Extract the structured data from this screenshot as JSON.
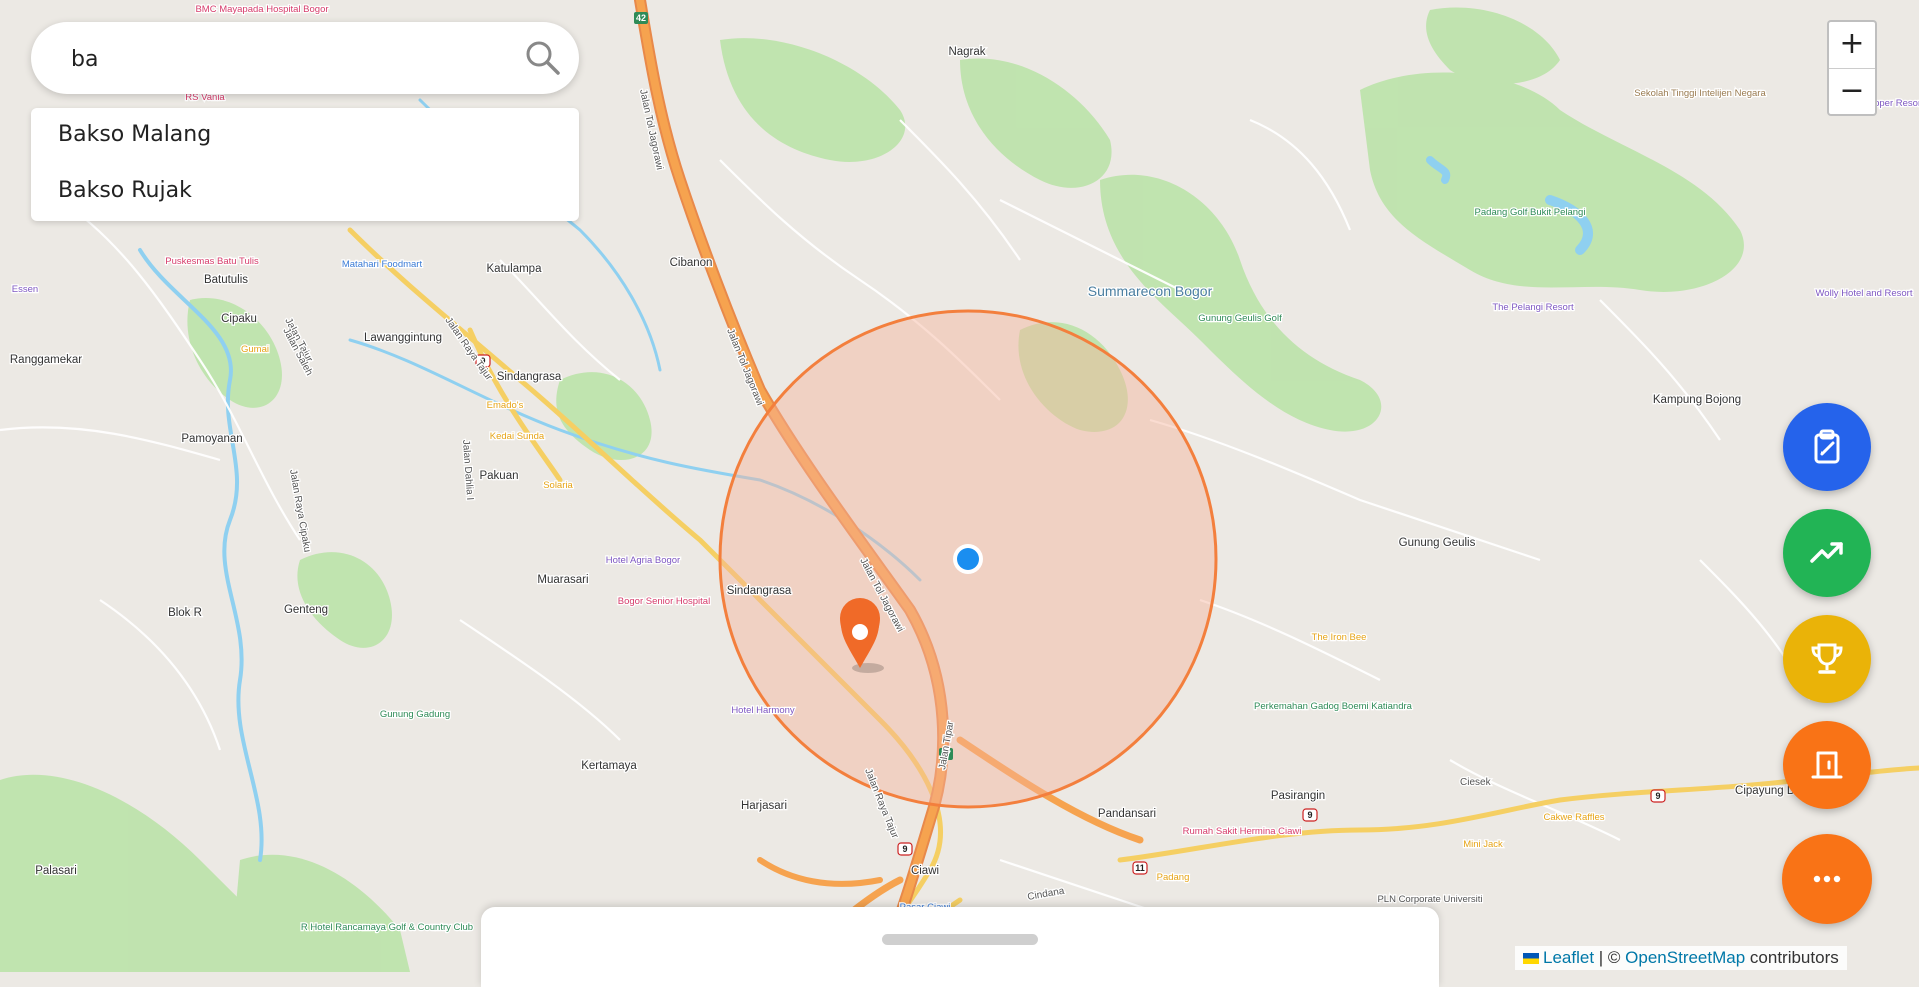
{
  "search": {
    "value": "ba",
    "placeholder": ""
  },
  "suggestions": [
    "Bakso Malang",
    "Bakso Rujak"
  ],
  "zoom": {
    "in_label": "+",
    "out_label": "−"
  },
  "attribution": {
    "leaflet": "Leaflet",
    "sep": " | © ",
    "osm": "OpenStreetMap",
    "suffix": " contributors"
  },
  "fabs": [
    {
      "name": "clipboard-icon",
      "color": "#2563eb"
    },
    {
      "name": "trend-up-icon",
      "color": "#22b455"
    },
    {
      "name": "trophy-icon",
      "color": "#eab308"
    },
    {
      "name": "exit-door-icon",
      "color": "#f97316"
    },
    {
      "name": "more-dots-icon",
      "color": "#f97316"
    }
  ],
  "colors": {
    "radius_fill": "#f7b49b",
    "radius_stroke": "#f37f3d",
    "user_dot": "#1a8ef0",
    "pin": "#f06a28",
    "park": "#a6dd92",
    "road_major": "#f39a3b",
    "road_secondary": "#f5cf63",
    "water": "#8fd0f0"
  },
  "map_labels": {
    "places": [
      "Nagrak",
      "Cibanon",
      "Katulampa",
      "Batutulis",
      "Cipaku",
      "Lawanggintung",
      "Ranggamekar",
      "Sindangrasa",
      "Pamoyanan",
      "Pakuan",
      "Muarasari",
      "Genteng",
      "Sindangrasa",
      "Kertamaya",
      "Harjasari",
      "Palasari",
      "Ciawi",
      "Pandansari",
      "Pasirangin",
      "Cipayung Datar",
      "Gunung Geulis",
      "Kampung Bojong",
      "Summarecon Bogor",
      "Blok R"
    ],
    "streets": [
      "Jalan Tol Jagorawi",
      "Jalan Tol Jagorawi",
      "Jalan Tol Jagorawi",
      "Jalan Raya Tajur",
      "Jalan Raya Tajur",
      "Jalan Tajur",
      "Jalan Raya Cipaku",
      "Jalan Saleh",
      "Jalan Dahlia I",
      "Jalan Tipar",
      "Ciesek",
      "Cindana"
    ],
    "pois": [
      "BMC Mayapada Hospital Bogor",
      "RS Vania",
      "Puskesmas Batu Tulis",
      "Matahari Foodmart",
      "Gumai",
      "Emado's",
      "Kedai Sunda",
      "Solaria",
      "Hotel Agria Bogor",
      "Bogor Senior Hospital",
      "Hotel Harmony",
      "Gunung Gadung",
      "R Hotel Rancamaya Golf & Country Club",
      "Pasar Ciawi",
      "Rumah Sakit Hermina Ciawi",
      "Padang",
      "PLN Corporate Universiti",
      "Mini Jack",
      "Cakwe Raffles",
      "Perkemahan Gadog Boemi Katiandra",
      "The Iron Bee",
      "Gunung Geulis Golf",
      "The Pelangi Resort",
      "Padang Golf Bukit Pelangi",
      "Wolly Hotel and Resort",
      "Sekolah Tinggi Intelijen Negara",
      "Upper Resort &",
      "Essen"
    ],
    "route_shields": [
      "42",
      "9",
      "9",
      "47",
      "9",
      "11",
      "9"
    ]
  }
}
